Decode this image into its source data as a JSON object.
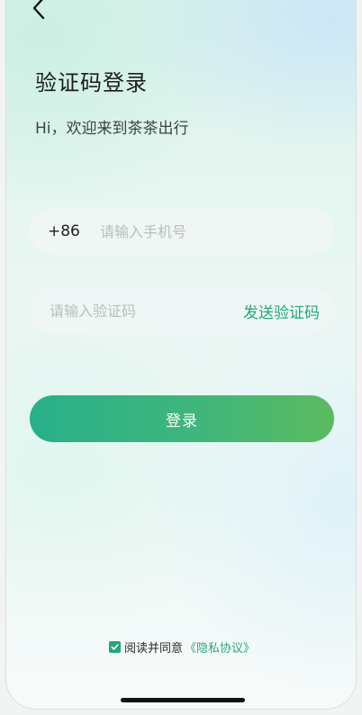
{
  "header": {
    "back_icon": "chevron-left-icon"
  },
  "title": "验证码登录",
  "subtitle": "Hi，欢迎来到茶茶出行",
  "phone": {
    "country_code": "+86",
    "placeholder": "请输入手机号",
    "value": ""
  },
  "code": {
    "placeholder": "请输入验证码",
    "value": "",
    "send_label": "发送验证码"
  },
  "login_label": "登录",
  "agreement": {
    "checked": true,
    "text": "阅读并同意",
    "link": "《隐私协议》"
  },
  "colors": {
    "accent": "#26a57c",
    "button_start": "#28b08a",
    "button_end": "#5bbb5e"
  }
}
